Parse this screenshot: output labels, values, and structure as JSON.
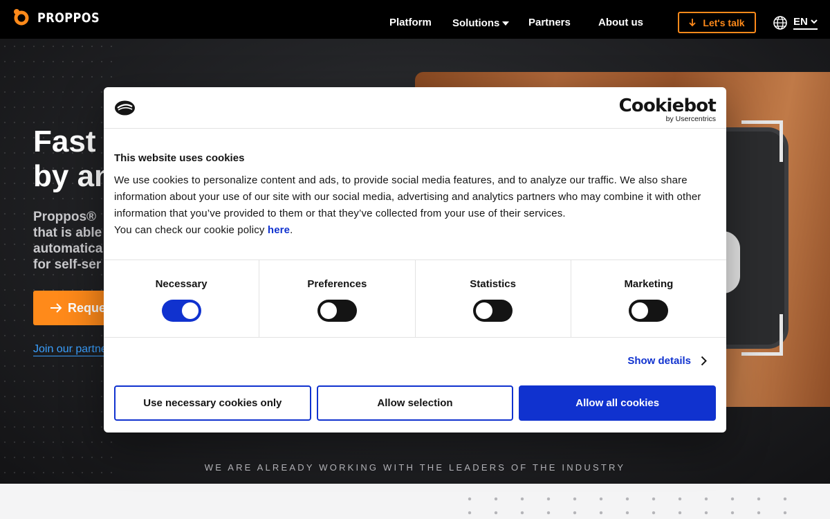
{
  "brand": {
    "name": "PROPPOS"
  },
  "nav": {
    "items": [
      "Platform",
      "Solutions",
      "Partners",
      "About us"
    ],
    "cta": "Let's talk",
    "language": "EN"
  },
  "hero": {
    "title_line1": "Fast",
    "title_line2": "by an",
    "subtitle_lines": [
      "Proppos®",
      "that is able",
      "automatica",
      "for self-ser"
    ],
    "button": "Reque",
    "link": "Join our partne",
    "leaders": "WE ARE ALREADY WORKING WITH THE LEADERS OF THE INDUSTRY"
  },
  "cookie": {
    "brand_main": "Cookiebot",
    "brand_sub": "by Usercentrics",
    "title": "This website uses cookies",
    "text": "We use cookies to personalize content and ads, to provide social media features, and to analyze our traffic. We also share information about your use of our site with our social media, advertising and analytics partners who may combine it with other information that you’ve provided to them or that they’ve collected from your use of their services.",
    "policy_prefix": "You can check our cookie policy ",
    "policy_link": "here",
    "policy_suffix": ".",
    "categories": [
      {
        "label": "Necessary",
        "enabled": true
      },
      {
        "label": "Preferences",
        "enabled": false
      },
      {
        "label": "Statistics",
        "enabled": false
      },
      {
        "label": "Marketing",
        "enabled": false
      }
    ],
    "show_details": "Show details",
    "buttons": {
      "necessary_only": "Use necessary cookies only",
      "allow_selection": "Allow selection",
      "allow_all": "Allow all cookies"
    }
  },
  "colors": {
    "accent": "#ff8a1a",
    "cookie_blue": "#1032cf"
  }
}
